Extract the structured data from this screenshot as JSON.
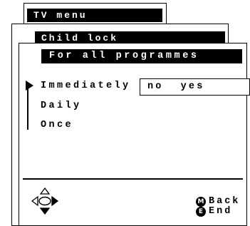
{
  "windows": [
    {
      "title": "TV menu"
    },
    {
      "title": "Child lock"
    },
    {
      "title": "For all programmes"
    }
  ],
  "menu": {
    "items": [
      {
        "label": "Immediately",
        "selected": true
      },
      {
        "label": "Daily"
      },
      {
        "label": "Once"
      }
    ],
    "options": {
      "no": "no",
      "yes": "yes"
    }
  },
  "footer": {
    "back_key": "M",
    "back_label": "Back",
    "end_key": "E",
    "end_label": "End"
  },
  "icons": [
    "navigation-pad-icon",
    "selection-pointer-icon",
    "m-button-icon",
    "e-button-icon"
  ]
}
